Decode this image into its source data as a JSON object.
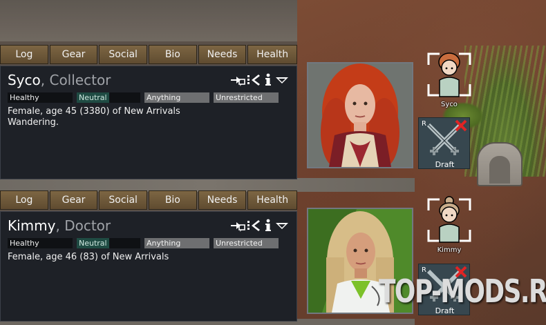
{
  "tabs": [
    "Log",
    "Gear",
    "Social",
    "Bio",
    "Needs",
    "Health"
  ],
  "colonists": [
    {
      "name": "Syco",
      "role": "Collector",
      "mood": "Healthy",
      "faction": "Neutral",
      "food": "Anything",
      "area": "Unrestricted",
      "desc_line1": "Female, age 45 (3380) of New Arrivals",
      "desc_line2": "Wandering.",
      "token_label": "Syco",
      "draft_label": "Draft",
      "draft_hotkey": "R",
      "hair_color": "#d2461e"
    },
    {
      "name": "Kimmy",
      "role": "Doctor",
      "mood": "Healthy",
      "faction": "Neutral",
      "food": "Anything",
      "area": "Unrestricted",
      "desc_line1": "Female, age 46 (83) of New Arrivals",
      "desc_line2": "",
      "token_label": "Kimmy",
      "draft_label": "Draft",
      "draft_hotkey": "R",
      "hair_color": "#d9c08a"
    }
  ],
  "icons": [
    "rename-icon",
    "banish-icon",
    "info-icon",
    "dropdown-icon"
  ],
  "watermark": "TOP-MODS.RU",
  "colors": {
    "tab_bg": "#6e5839",
    "panel_bg": "#1e2127",
    "tag_gray": "#6e6f71",
    "neutral_teal": "#1f4b43",
    "draft_bg": "#37474f",
    "cancel_red": "#e02424"
  }
}
